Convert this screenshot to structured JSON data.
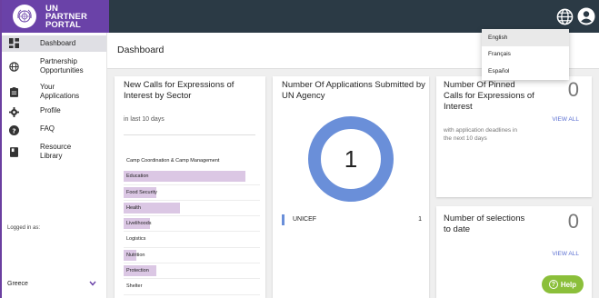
{
  "brand": {
    "line1": "UN",
    "line2": "PARTNER",
    "line3": "PORTAL"
  },
  "header": {
    "language_icon": "globe-icon",
    "account_icon": "account-circle-icon"
  },
  "sidebar": {
    "items": [
      {
        "label": "Dashboard",
        "icon": "dashboard-icon",
        "active": true
      },
      {
        "label": "Partnership Opportunities",
        "icon": "globe-icon"
      },
      {
        "label": "Your Applications",
        "icon": "assignment-icon"
      },
      {
        "label": "Profile",
        "icon": "gear-icon"
      },
      {
        "label": "FAQ",
        "icon": "help-icon"
      },
      {
        "label": "Resource Library",
        "icon": "book-icon"
      }
    ],
    "logged_in_label": "Logged in as:",
    "country": "Greece"
  },
  "page": {
    "title": "Dashboard"
  },
  "sector_card": {
    "title": "New Calls for Expressions of Interest by Sector",
    "subtitle": "in last 10 days",
    "rows": [
      {
        "label": "Camp Coordination & Camp Management",
        "fraction": 0.0
      },
      {
        "label": "Education",
        "fraction": 0.89
      },
      {
        "label": "Food Security",
        "fraction": 0.24
      },
      {
        "label": "Health",
        "fraction": 0.41
      },
      {
        "label": "Livelihoods",
        "fraction": 0.19
      },
      {
        "label": "Logistics",
        "fraction": 0.0
      },
      {
        "label": "Nutrition",
        "fraction": 0.09
      },
      {
        "label": "Protection",
        "fraction": 0.24
      },
      {
        "label": "Shelter",
        "fraction": 0.0
      }
    ]
  },
  "agency_card": {
    "title": "Number Of Applications Submitted by UN Agency",
    "total": "1",
    "legend": [
      {
        "name": "UNICEF",
        "value": "1",
        "color": "#6a8fd9"
      }
    ]
  },
  "pinned_card": {
    "title": "Number Of Pinned Calls for Expressions of Interest",
    "count": "0",
    "subtitle": "with application deadlines in the next 10 days",
    "view_all": "VIEW ALL"
  },
  "selections_card": {
    "title": "Number of selections to date",
    "count": "0",
    "view_all": "VIEW ALL"
  },
  "language_menu": {
    "options": [
      "English",
      "Français",
      "Español"
    ],
    "selected": "English"
  },
  "help_button": {
    "label": "Help"
  },
  "colors": {
    "brand_purple": "#6a42a8",
    "topbar": "#2b3a45",
    "bar_fill": "#dbc7e4",
    "donut": "#6a8fd9",
    "help_green": "#8bbf3a",
    "link_blue": "#5a6fd1"
  }
}
